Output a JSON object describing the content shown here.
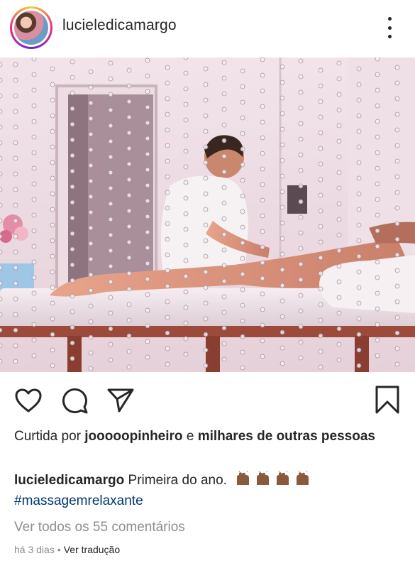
{
  "post": {
    "username": "lucieledicamargo",
    "likes": {
      "prefix": "Curtida por",
      "user": "jooooopinheiro",
      "connector": "e",
      "others": "milhares de outras pessoas"
    },
    "caption": {
      "username": "lucieledicamargo",
      "text": "Primeira do ano.",
      "emoji": "clapping-hands-x4",
      "hashtag": "#massagemrelaxante"
    },
    "view_comments": "Ver todos os 55 comentários",
    "time_ago": "há 3 dias",
    "separator": "•",
    "translate": "Ver tradução"
  },
  "icons": {
    "like": "heart-icon",
    "comment": "comment-icon",
    "share": "paper-plane-icon",
    "save": "bookmark-icon",
    "more": "more-vertical-icon"
  },
  "colors": {
    "text": "#262626",
    "muted": "#8e8e8e",
    "hashtag": "#00376b",
    "background": "#ffffff"
  }
}
